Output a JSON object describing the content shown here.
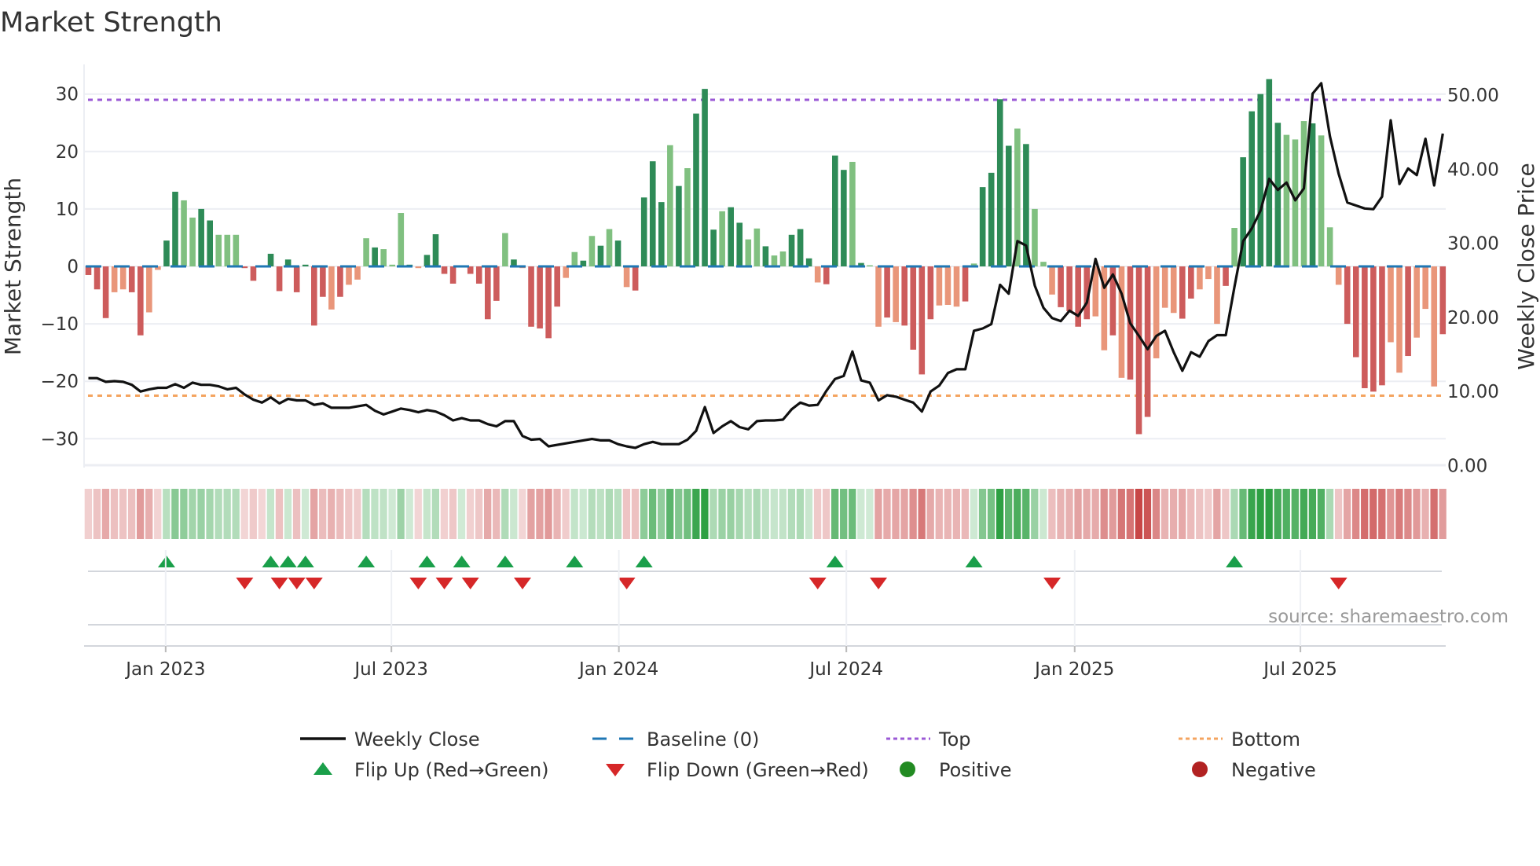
{
  "title": "Market Strength",
  "source": "source: sharemaestro.com",
  "colors": {
    "bar_pos_dark": "#2e8b57",
    "bar_pos_light": "#80c080",
    "bar_neg_dark": "#cd5c5c",
    "bar_neg_light": "#e9967a",
    "close_line": "#111111",
    "baseline": "#1f77b4",
    "top": "#9b59d6",
    "bottom": "#f4a460",
    "flip_up": "#1a9f4a",
    "flip_down": "#d62728",
    "positive": "#228b22",
    "negative": "#b22222"
  },
  "chart_data": {
    "type": "bar+line",
    "title": "Market Strength",
    "ylabel": "Market Strength",
    "y2label": "Weekly Close Price",
    "ylim": [
      -35,
      35
    ],
    "y2lim": [
      0,
      55
    ],
    "grid": true,
    "y_ticks": [
      "30",
      "20",
      "10",
      "0",
      "−10",
      "−20",
      "−30"
    ],
    "y_tick_values": [
      30,
      20,
      10,
      0,
      -10,
      -20,
      -30
    ],
    "y2_ticks": [
      "50.00",
      "40.00",
      "30.00",
      "20.00",
      "10.00",
      "0.00"
    ],
    "y2_tick_values": [
      50,
      40,
      30,
      20,
      10,
      0
    ],
    "x_ticks": [
      {
        "label": "Jan 2023",
        "week_index": 8.9
      },
      {
        "label": "Jul 2023",
        "week_index": 34.9
      },
      {
        "label": "Jan 2024",
        "week_index": 61.1
      },
      {
        "label": "Jul 2024",
        "week_index": 87.3
      },
      {
        "label": "Jan 2025",
        "week_index": 113.6
      },
      {
        "label": "Jul 2025",
        "week_index": 139.6
      }
    ],
    "reference_lines": {
      "top": 29,
      "bottom": -22.5,
      "baseline": 0
    },
    "strength": [
      -1.5,
      -4,
      -9,
      -4.5,
      -4,
      -4.5,
      -12,
      -8,
      -0.6,
      4.5,
      13,
      11.5,
      8.5,
      10,
      8,
      5.5,
      5.5,
      5.5,
      -0.3,
      -2.5,
      -0.2,
      2.2,
      -4.3,
      1.2,
      -4.5,
      0.3,
      -10.3,
      -5.3,
      -7.5,
      -5.3,
      -3.2,
      -2.3,
      4.9,
      3.3,
      3,
      0.3,
      9.3,
      0.3,
      -0.3,
      2,
      5.6,
      -1.3,
      -3,
      0.2,
      -1.3,
      -3,
      -9.2,
      -6,
      5.8,
      1.2,
      -0.3,
      -10.5,
      -10.8,
      -12.5,
      -7,
      -2,
      2.5,
      1,
      5.3,
      3.6,
      6.5,
      4.5,
      -3.6,
      -4.2,
      12,
      18.3,
      11.2,
      21.1,
      14,
      17.1,
      26.6,
      30.9,
      6.4,
      9.6,
      10.3,
      7.6,
      4.7,
      6.6,
      3.5,
      1.9,
      2.6,
      5.5,
      6.5,
      1.4,
      -2.8,
      -3.1,
      19.3,
      16.8,
      18.2,
      0.6,
      0.2,
      -10.5,
      -8.9,
      -9.7,
      -10.3,
      -14.5,
      -18.8,
      -9.2,
      -6.8,
      -6.7,
      -7,
      -6.1,
      0.5,
      13.8,
      16.3,
      29.1,
      21,
      24,
      21.3,
      10,
      0.8,
      -4.9,
      -7.1,
      -7.8,
      -10.5,
      -9.2,
      -8.7,
      -14.6,
      -12,
      -19.4,
      -19.7,
      -29.2,
      -26.2,
      -16,
      -7.2,
      -8.1,
      -9.1,
      -5.6,
      -4,
      -2.2,
      -10,
      -3.4,
      6.7,
      19,
      27,
      30,
      32.6,
      25,
      22.9,
      22.1,
      25.3,
      24.9,
      22.8,
      6.8,
      -3.2,
      -10,
      -15.8,
      -21.2,
      -21.8,
      -20.7,
      -13.2,
      -18.5,
      -15.6,
      -12.4,
      -7.4,
      -20.9,
      -11.8
    ],
    "shade": "dddlldd lld dllddlllddd dddddddldl lldllldldd dddddddldl ddddlldldl dlddddldld ddlddlldll dddldddldl ldlddddlll dlddddldll lddddlldld ddlllddlll dldddddlll dllldddddl ldllldl",
    "weekly_close": [
      11.8,
      11.8,
      11.3,
      11.4,
      11.3,
      10.9,
      10.0,
      10.3,
      10.5,
      10.5,
      11.0,
      10.5,
      11.2,
      10.9,
      10.9,
      10.7,
      10.3,
      10.5,
      9.6,
      8.9,
      8.5,
      9.2,
      8.4,
      9.0,
      8.8,
      8.8,
      8.2,
      8.4,
      7.8,
      7.8,
      7.8,
      8.0,
      8.2,
      7.4,
      6.9,
      7.3,
      7.7,
      7.5,
      7.2,
      7.5,
      7.3,
      6.8,
      6.1,
      6.4,
      6.1,
      6.1,
      5.6,
      5.3,
      6.0,
      6.0,
      4.0,
      3.5,
      3.6,
      2.6,
      2.8,
      3.0,
      3.2,
      3.4,
      3.6,
      3.4,
      3.4,
      2.9,
      2.6,
      2.4,
      2.9,
      3.2,
      2.9,
      2.9,
      2.9,
      3.5,
      4.7,
      7.9,
      4.4,
      5.3,
      6.0,
      5.2,
      4.9,
      6.0,
      6.1,
      6.1,
      6.2,
      7.6,
      8.5,
      8.1,
      8.2,
      10.1,
      11.7,
      12.1,
      15.4,
      11.5,
      11.2,
      8.8,
      9.5,
      9.3,
      8.9,
      8.5,
      7.3,
      10.0,
      10.8,
      12.5,
      13.0,
      13.0,
      18.2,
      18.5,
      19.1,
      24.4,
      23.2,
      30.3,
      29.7,
      24.3,
      21.3,
      19.9,
      19.5,
      20.9,
      20.2,
      22.0,
      27.9,
      24.0,
      25.8,
      23.2,
      19.2,
      17.5,
      15.7,
      17.5,
      18.2,
      15.3,
      12.8,
      15.3,
      14.7,
      16.8,
      17.6,
      17.6,
      24.1,
      30.3,
      32.0,
      34.4,
      38.7,
      37.2,
      38.2,
      35.8,
      37.4,
      50.2,
      51.6,
      44.4,
      39.4,
      35.5,
      35.1,
      34.7,
      34.6,
      36.3,
      46.6,
      38.0,
      40.1,
      39.2,
      44.1,
      37.8,
      44.8
    ],
    "flip_up_weeks": [
      9,
      21,
      23,
      25,
      32,
      39,
      43,
      48,
      56,
      64,
      86,
      102,
      132
    ],
    "flip_down_weeks": [
      18,
      22,
      24,
      26,
      38,
      41,
      44,
      50,
      62,
      84,
      91,
      111,
      144
    ],
    "legend": [
      {
        "label": "Weekly Close",
        "kind": "line"
      },
      {
        "label": "Baseline (0)",
        "kind": "dash"
      },
      {
        "label": "Top",
        "kind": "dot-purple"
      },
      {
        "label": "Bottom",
        "kind": "dot-orange"
      },
      {
        "label": "Flip Up (Red→Green)",
        "kind": "tri-up"
      },
      {
        "label": "Flip Down (Green→Red)",
        "kind": "tri-down"
      },
      {
        "label": "Positive",
        "kind": "dot-green"
      },
      {
        "label": "Negative",
        "kind": "dot-red"
      }
    ],
    "legend_placement": "bottom"
  }
}
